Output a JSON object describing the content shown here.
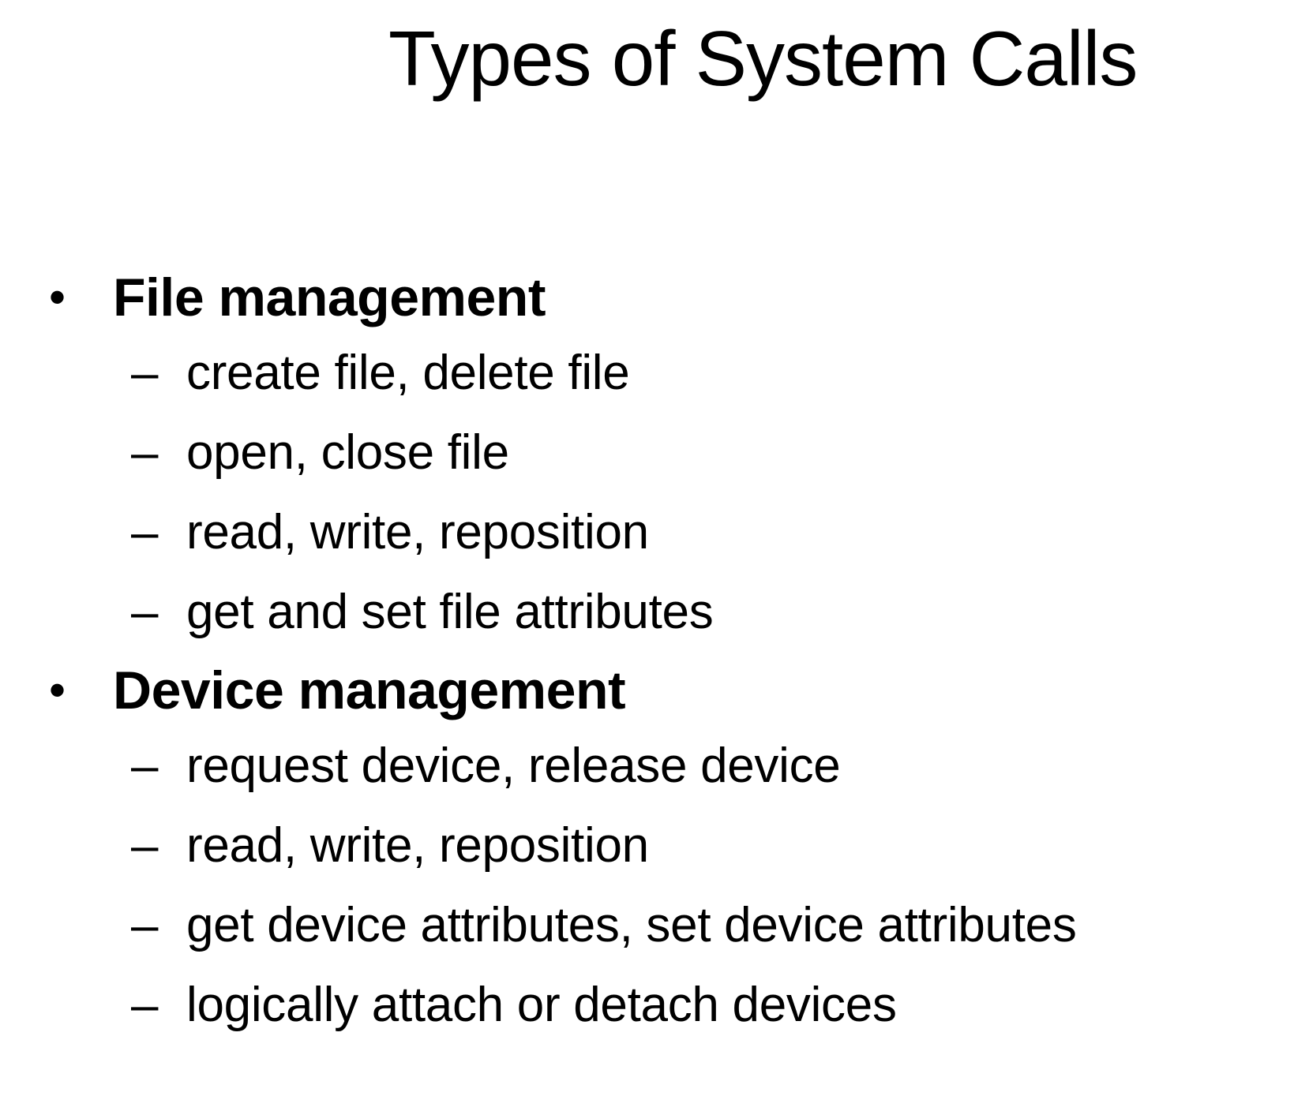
{
  "slide": {
    "title": "Types of System Calls"
  },
  "sections": [
    {
      "bullet": "•",
      "heading": "File management",
      "items": [
        "create file, delete file",
        "open, close file",
        "read, write, reposition",
        "get and set file attributes"
      ]
    },
    {
      "bullet": "•",
      "heading": "Device management",
      "items": [
        "request device, release device",
        "read, write, reposition",
        "get device attributes, set device attributes",
        "logically attach or detach devices"
      ]
    }
  ],
  "dash": "–"
}
